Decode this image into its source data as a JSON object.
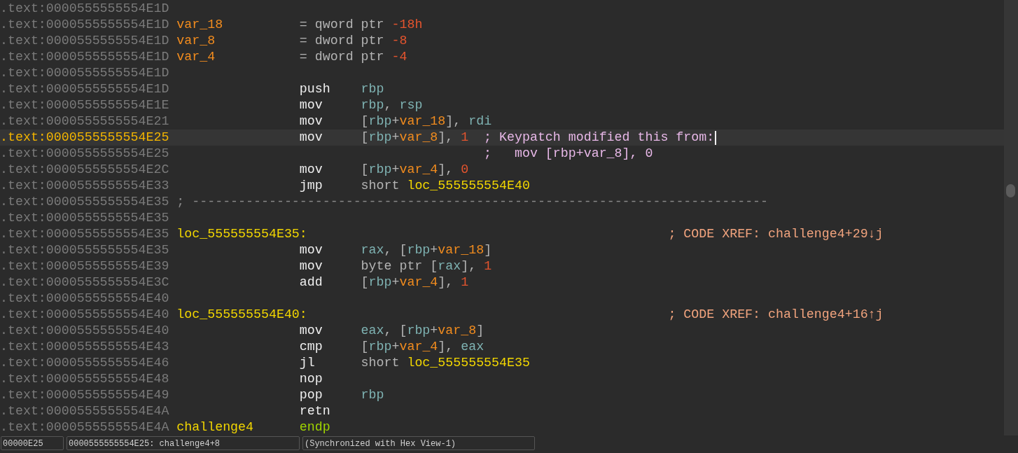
{
  "lines": [
    {
      "address": ".text:0000555555554E1D",
      "selected": false,
      "kind": "blank"
    },
    {
      "address": ".text:0000555555554E1D",
      "selected": false,
      "kind": "stackvar",
      "label": {
        "text": "var_18",
        "kind": "var"
      },
      "mnemonic": "=",
      "operands": [
        {
          "text": "qword ptr ",
          "kind": "plain"
        },
        {
          "text": "-18h",
          "kind": "num"
        }
      ]
    },
    {
      "address": ".text:0000555555554E1D",
      "selected": false,
      "kind": "stackvar",
      "label": {
        "text": "var_8",
        "kind": "var"
      },
      "mnemonic": "=",
      "operands": [
        {
          "text": "dword ptr ",
          "kind": "plain"
        },
        {
          "text": "-8",
          "kind": "num"
        }
      ]
    },
    {
      "address": ".text:0000555555554E1D",
      "selected": false,
      "kind": "stackvar",
      "label": {
        "text": "var_4",
        "kind": "var"
      },
      "mnemonic": "=",
      "operands": [
        {
          "text": "dword ptr ",
          "kind": "plain"
        },
        {
          "text": "-4",
          "kind": "num"
        }
      ]
    },
    {
      "address": ".text:0000555555554E1D",
      "selected": false,
      "kind": "blank"
    },
    {
      "address": ".text:0000555555554E1D",
      "selected": false,
      "kind": "instr",
      "mnemonic": "push",
      "operands": [
        {
          "text": "rbp",
          "kind": "reg"
        }
      ]
    },
    {
      "address": ".text:0000555555554E1E",
      "selected": false,
      "kind": "instr",
      "mnemonic": "mov",
      "operands": [
        {
          "text": "rbp",
          "kind": "reg"
        },
        {
          "text": ", ",
          "kind": "plain"
        },
        {
          "text": "rsp",
          "kind": "reg"
        }
      ]
    },
    {
      "address": ".text:0000555555554E21",
      "selected": false,
      "kind": "instr",
      "mnemonic": "mov",
      "operands": [
        {
          "text": "[",
          "kind": "plain"
        },
        {
          "text": "rbp",
          "kind": "reg"
        },
        {
          "text": "+",
          "kind": "plain"
        },
        {
          "text": "var_18",
          "kind": "var"
        },
        {
          "text": "], ",
          "kind": "plain"
        },
        {
          "text": "rdi",
          "kind": "reg"
        }
      ]
    },
    {
      "address": ".text:0000555555554E25",
      "selected": true,
      "kind": "instr",
      "mnemonic": "mov",
      "operands": [
        {
          "text": "[",
          "kind": "plain"
        },
        {
          "text": "rbp",
          "kind": "reg"
        },
        {
          "text": "+",
          "kind": "plain"
        },
        {
          "text": "var_8",
          "kind": "var"
        },
        {
          "text": "], ",
          "kind": "plain"
        },
        {
          "text": "1",
          "kind": "num"
        }
      ],
      "comment": {
        "text": "; Keypatch modified this from:",
        "kind": "patch"
      }
    },
    {
      "address": ".text:0000555555554E25",
      "selected": false,
      "kind": "instr",
      "comment": {
        "text": ";   mov [rbp+var_8], 0",
        "kind": "patch"
      }
    },
    {
      "address": ".text:0000555555554E2C",
      "selected": false,
      "kind": "instr",
      "mnemonic": "mov",
      "operands": [
        {
          "text": "[",
          "kind": "plain"
        },
        {
          "text": "rbp",
          "kind": "reg"
        },
        {
          "text": "+",
          "kind": "plain"
        },
        {
          "text": "var_4",
          "kind": "var"
        },
        {
          "text": "], ",
          "kind": "plain"
        },
        {
          "text": "0",
          "kind": "num"
        }
      ]
    },
    {
      "address": ".text:0000555555554E33",
      "selected": false,
      "kind": "instr",
      "mnemonic": "jmp",
      "operands": [
        {
          "text": "short ",
          "kind": "plain"
        },
        {
          "text": "loc_555555554E40",
          "kind": "loc"
        }
      ]
    },
    {
      "address": ".text:0000555555554E35",
      "selected": false,
      "kind": "separator",
      "text": "; ---------------------------------------------------------------------------"
    },
    {
      "address": ".text:0000555555554E35",
      "selected": false,
      "kind": "blank"
    },
    {
      "address": ".text:0000555555554E35",
      "selected": false,
      "kind": "labelline",
      "label": {
        "text": "loc_555555554E35:",
        "kind": "loc"
      },
      "comment": {
        "text": "; CODE XREF: challenge4+29↓j",
        "kind": "xref"
      }
    },
    {
      "address": ".text:0000555555554E35",
      "selected": false,
      "kind": "instr",
      "mnemonic": "mov",
      "operands": [
        {
          "text": "rax",
          "kind": "reg"
        },
        {
          "text": ", [",
          "kind": "plain"
        },
        {
          "text": "rbp",
          "kind": "reg"
        },
        {
          "text": "+",
          "kind": "plain"
        },
        {
          "text": "var_18",
          "kind": "var"
        },
        {
          "text": "]",
          "kind": "plain"
        }
      ]
    },
    {
      "address": ".text:0000555555554E39",
      "selected": false,
      "kind": "instr",
      "mnemonic": "mov",
      "operands": [
        {
          "text": "byte ptr [",
          "kind": "plain"
        },
        {
          "text": "rax",
          "kind": "reg"
        },
        {
          "text": "], ",
          "kind": "plain"
        },
        {
          "text": "1",
          "kind": "num"
        }
      ]
    },
    {
      "address": ".text:0000555555554E3C",
      "selected": false,
      "kind": "instr",
      "mnemonic": "add",
      "operands": [
        {
          "text": "[",
          "kind": "plain"
        },
        {
          "text": "rbp",
          "kind": "reg"
        },
        {
          "text": "+",
          "kind": "plain"
        },
        {
          "text": "var_4",
          "kind": "var"
        },
        {
          "text": "], ",
          "kind": "plain"
        },
        {
          "text": "1",
          "kind": "num"
        }
      ]
    },
    {
      "address": ".text:0000555555554E40",
      "selected": false,
      "kind": "blank"
    },
    {
      "address": ".text:0000555555554E40",
      "selected": false,
      "kind": "labelline",
      "label": {
        "text": "loc_555555554E40:",
        "kind": "loc"
      },
      "comment": {
        "text": "; CODE XREF: challenge4+16↑j",
        "kind": "xref"
      }
    },
    {
      "address": ".text:0000555555554E40",
      "selected": false,
      "kind": "instr",
      "mnemonic": "mov",
      "operands": [
        {
          "text": "eax",
          "kind": "reg"
        },
        {
          "text": ", [",
          "kind": "plain"
        },
        {
          "text": "rbp",
          "kind": "reg"
        },
        {
          "text": "+",
          "kind": "plain"
        },
        {
          "text": "var_8",
          "kind": "var"
        },
        {
          "text": "]",
          "kind": "plain"
        }
      ]
    },
    {
      "address": ".text:0000555555554E43",
      "selected": false,
      "kind": "instr",
      "mnemonic": "cmp",
      "operands": [
        {
          "text": "[",
          "kind": "plain"
        },
        {
          "text": "rbp",
          "kind": "reg"
        },
        {
          "text": "+",
          "kind": "plain"
        },
        {
          "text": "var_4",
          "kind": "var"
        },
        {
          "text": "], ",
          "kind": "plain"
        },
        {
          "text": "eax",
          "kind": "reg"
        }
      ]
    },
    {
      "address": ".text:0000555555554E46",
      "selected": false,
      "kind": "instr",
      "mnemonic": "jl",
      "operands": [
        {
          "text": "short ",
          "kind": "plain"
        },
        {
          "text": "loc_555555554E35",
          "kind": "loc"
        }
      ]
    },
    {
      "address": ".text:0000555555554E48",
      "selected": false,
      "kind": "instr",
      "mnemonic": "nop"
    },
    {
      "address": ".text:0000555555554E49",
      "selected": false,
      "kind": "instr",
      "mnemonic": "pop",
      "operands": [
        {
          "text": "rbp",
          "kind": "reg"
        }
      ]
    },
    {
      "address": ".text:0000555555554E4A",
      "selected": false,
      "kind": "instr",
      "mnemonic": "retn"
    },
    {
      "address": ".text:0000555555554E4A",
      "selected": false,
      "kind": "endp",
      "label": {
        "text": "challenge4",
        "kind": "loc"
      },
      "mnemonic": "endp"
    }
  ],
  "status_bar": [
    "00000E25",
    "0000555555554E25: challenge4+8",
    "(Synchronized with Hex View-1)"
  ]
}
